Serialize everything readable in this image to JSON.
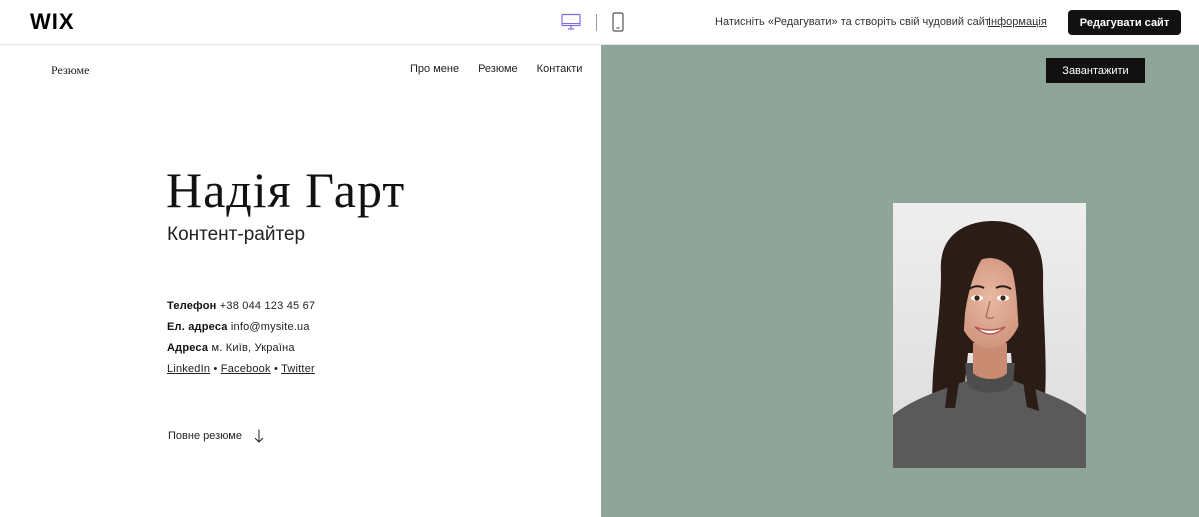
{
  "topbar": {
    "logo": "WIX",
    "message": "Натисніть «Редагувати» та створіть свій чудовий сайт",
    "info_link": "Інформація",
    "edit_button": "Редагувати сайт"
  },
  "site": {
    "logo": "Резюме",
    "nav": [
      "Про мене",
      "Резюме",
      "Контакти"
    ],
    "name": "Надія Гарт",
    "role": "Контент-райтер",
    "contacts": {
      "phone_label": "Телефон",
      "phone_value": "+38 044 123 45 67",
      "email_label": "Ел. адреса",
      "email_value": "info@mysite.ua",
      "address_label": "Адреса",
      "address_value": "м. Київ, Україна"
    },
    "social": [
      "LinkedIn",
      "Facebook",
      "Twitter"
    ],
    "full_cv": "Повне резюме",
    "download_button": "Завантажити"
  },
  "colors": {
    "panel_green": "#8fa59a",
    "topbar_device_active": "#7b6ce0",
    "button_dark": "#111111"
  },
  "icons": {
    "device_desktop": "desktop-icon",
    "device_mobile": "mobile-icon",
    "full_cv_arrow": "arrow-down-icon"
  }
}
